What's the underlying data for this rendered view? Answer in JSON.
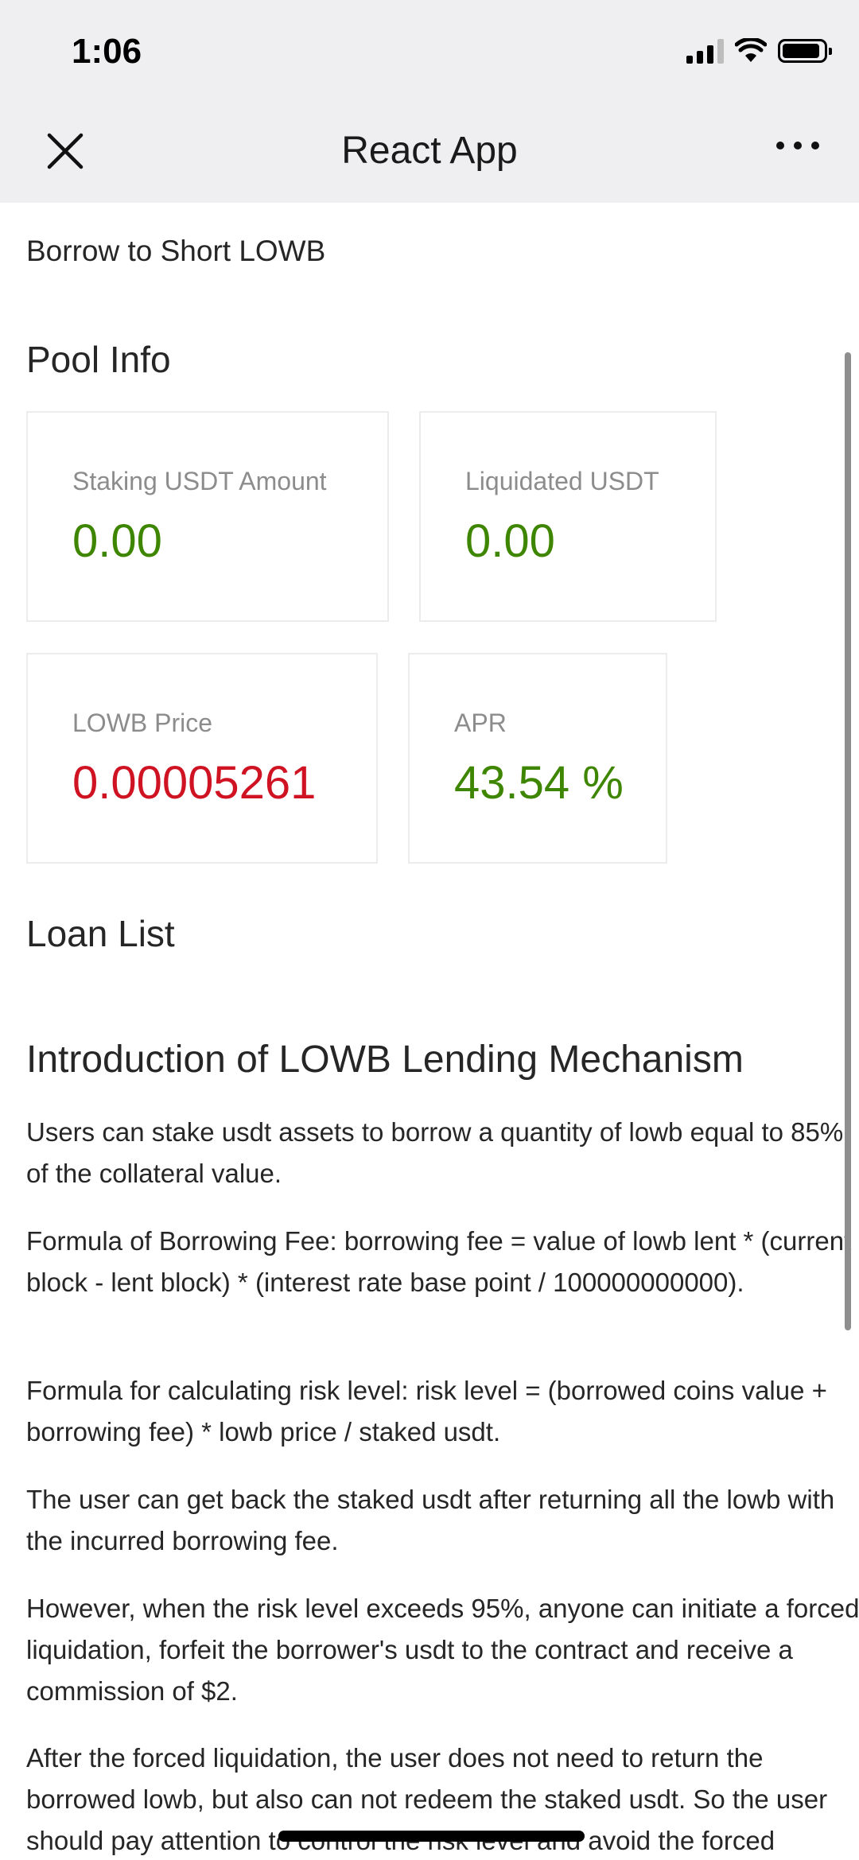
{
  "status_bar": {
    "time": "1:06"
  },
  "nav": {
    "title": "React App"
  },
  "page": {
    "heading": "Borrow to Short LOWB"
  },
  "pool_info": {
    "title": "Pool Info",
    "staking_usdt": {
      "label": "Staking USDT Amount",
      "value": "0.00"
    },
    "liquidated_usdt": {
      "label": "Liquidated USDT",
      "value": "0.00"
    },
    "lowb_price": {
      "label": "LOWB Price",
      "value": "0.00005261"
    },
    "apr": {
      "label": "APR",
      "value": "43.54 %"
    }
  },
  "loan_list": {
    "title": "Loan List"
  },
  "introduction": {
    "title": "Introduction of LOWB Lending Mechanism",
    "paragraphs": [
      "Users can stake usdt assets to borrow a quantity of lowb equal to 85% of the collateral value.",
      "Formula of Borrowing Fee: borrowing fee = value of lowb lent * (current block - lent block) * (interest rate base point / 100000000000).",
      "Formula for calculating risk level: risk level = (borrowed coins value + borrowing fee) * lowb price / staked usdt.",
      "The user can get back the staked usdt after returning all the lowb with the incurred borrowing fee.",
      "However, when the risk level exceeds 95%, anyone can initiate a forced liquidation, forfeit the borrower's usdt to the contract and receive a commission of $2.",
      "After the forced liquidation, the user does not need to return the borrowed lowb, but also can not redeem the staked usdt. So the user should pay attention to control the risk level and avoid the forced"
    ]
  },
  "colors": {
    "positive": "#3f8600",
    "negative": "#cf1322",
    "label": "#8c8c8c"
  }
}
